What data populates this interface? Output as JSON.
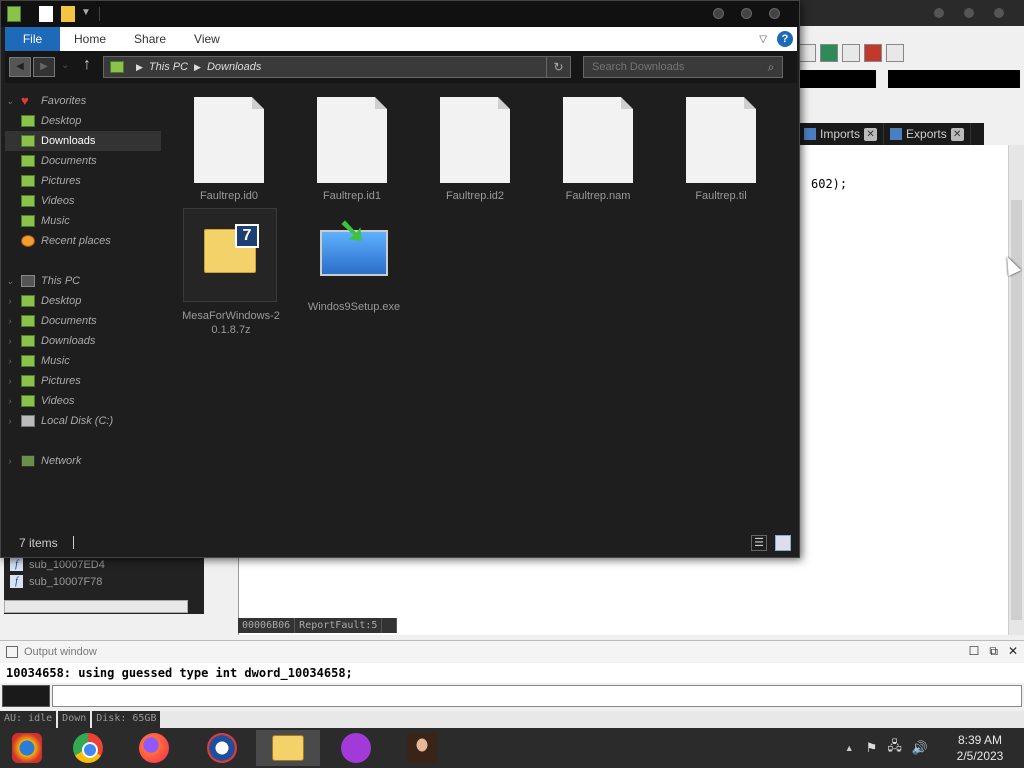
{
  "explorer": {
    "ribbon": {
      "file": "File",
      "tabs": [
        "Home",
        "Share",
        "View"
      ],
      "help": "?"
    },
    "address": {
      "crumbs": [
        "This PC",
        "Downloads"
      ],
      "search_placeholder": "Search Downloads"
    },
    "navpane": {
      "favorites": "Favorites",
      "favorites_items": [
        "Desktop",
        "Downloads",
        "Documents",
        "Pictures",
        "Videos",
        "Music",
        "Recent places"
      ],
      "this_pc": "This PC",
      "this_pc_items": [
        "Desktop",
        "Documents",
        "Downloads",
        "Music",
        "Pictures",
        "Videos",
        "Local Disk (C:)"
      ],
      "network": "Network"
    },
    "files": [
      {
        "name": "Faultrep.id0",
        "type": "document"
      },
      {
        "name": "Faultrep.id1",
        "type": "document"
      },
      {
        "name": "Faultrep.id2",
        "type": "document"
      },
      {
        "name": "Faultrep.nam",
        "type": "document"
      },
      {
        "name": "Faultrep.til",
        "type": "document"
      },
      {
        "name": "MesaForWindows-20.1.8.7z",
        "type": "7z-archive"
      },
      {
        "name": "Windos9Setup.exe",
        "type": "installer"
      }
    ],
    "status": {
      "item_count": "7 items"
    }
  },
  "ida": {
    "tabs": [
      {
        "label": "Imports",
        "icon": "imports-icon"
      },
      {
        "label": "Exports",
        "icon": "exports-icon"
      }
    ],
    "code_line": "602);",
    "functions": [
      "sub_10007ED4",
      "sub_10007F78"
    ],
    "strip": [
      "00006B06",
      "ReportFault:5"
    ],
    "output_title": "Output window",
    "output_line": "10034658: using guessed type int dword_10034658;",
    "statusbar": [
      "AU:  idle",
      "Down",
      "Disk: 65GB"
    ]
  },
  "taskbar": {
    "time": "8:39 AM",
    "date": "2/5/2023"
  },
  "colors": {
    "accent": "#1e6ab8",
    "explorer_bg": "#1e1e1e",
    "taskbar_bg": "#2b2b2b"
  }
}
